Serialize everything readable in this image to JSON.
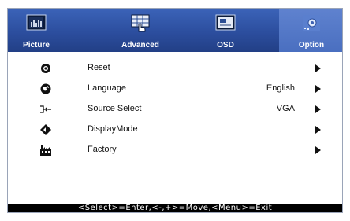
{
  "colors": {
    "tabbar_bg": "#2c4e9e",
    "active_tab_bg": "#4a6fc0",
    "status_bg": "#000000",
    "status_text": "#ffffff"
  },
  "tabs": [
    {
      "label": "Picture",
      "icon": "picture-icon",
      "active": false
    },
    {
      "label": "Advanced",
      "icon": "advanced-icon",
      "active": false
    },
    {
      "label": "OSD",
      "icon": "osd-icon",
      "active": false
    },
    {
      "label": "Option",
      "icon": "option-icon",
      "active": true
    }
  ],
  "menu": {
    "items": [
      {
        "label": "Reset",
        "value": "",
        "icon": "reset-icon"
      },
      {
        "label": "Language",
        "value": "English",
        "icon": "language-icon"
      },
      {
        "label": "Source Select",
        "value": "VGA",
        "icon": "source-icon"
      },
      {
        "label": "DisplayMode",
        "value": "",
        "icon": "display-mode-icon"
      },
      {
        "label": "Factory",
        "value": "",
        "icon": "factory-icon"
      }
    ]
  },
  "status": {
    "text": "<Select>=Enter,<-,+>=Move,<Menu>=Exit"
  }
}
